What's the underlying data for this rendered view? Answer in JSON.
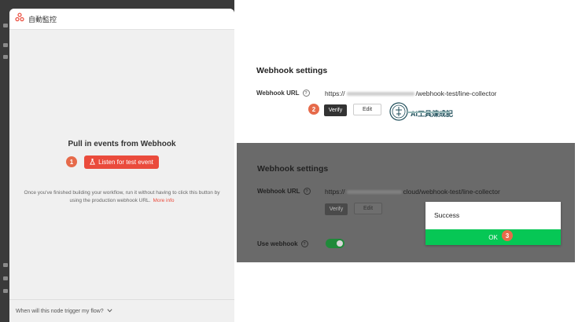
{
  "left_panel": {
    "node_title": "自動監控",
    "pull_title": "Pull in events from Webhook",
    "listen_button": "Listen for test event",
    "help_text": "Once you've finished building your workflow, run it without having to click this button by using the production webhook URL.",
    "more_info": "More info",
    "footer_text": "When will this node trigger my flow?"
  },
  "top_section": {
    "title": "Webhook settings",
    "url_label": "Webhook URL",
    "url_prefix": "https://",
    "url_suffix": "/webhook-test/line-collector",
    "verify_button": "Verify",
    "edit_button": "Edit",
    "logo_text": "AI工具煉成記"
  },
  "bottom_section": {
    "title": "Webhook settings",
    "url_label": "Webhook URL",
    "url_prefix": "https://",
    "url_suffix": "cloud/webhook-test/line-collector",
    "verify_button": "Verify",
    "edit_button": "Edit",
    "use_webhook_label": "Use webhook",
    "use_webhook_on": true
  },
  "dialog": {
    "message": "Success",
    "ok_button": "OK"
  },
  "steps": [
    "1",
    "2",
    "3"
  ],
  "colors": {
    "accent": "#ea4b3c",
    "step_badge": "#e66a4a",
    "line_green": "#06c755"
  }
}
